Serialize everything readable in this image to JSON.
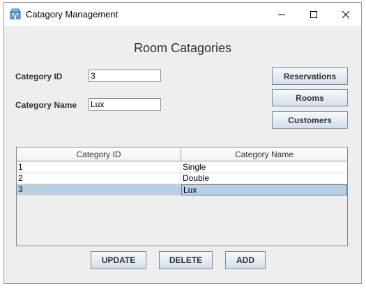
{
  "window": {
    "title": "Catagory Management",
    "controls": [
      "minimize",
      "maximize",
      "close"
    ]
  },
  "heading": "Room Catagories",
  "form": {
    "category_id_label": "Category ID",
    "category_id_value": "3",
    "category_name_label": "Category Name",
    "category_name_value": "Lux"
  },
  "nav": {
    "reservations": "Reservations",
    "rooms": "Rooms",
    "customers": "Customers"
  },
  "table": {
    "columns": [
      "Category ID",
      "Category Name"
    ],
    "rows": [
      {
        "id": "1",
        "name": "Single"
      },
      {
        "id": "2",
        "name": "Double"
      },
      {
        "id": "3",
        "name": "Lux",
        "selected": true
      }
    ]
  },
  "actions": {
    "update": "UPDATE",
    "delete": "DELETE",
    "add": "ADD"
  },
  "colors": {
    "window_bg": "#eeeeee",
    "selection": "#b8cfe5"
  }
}
